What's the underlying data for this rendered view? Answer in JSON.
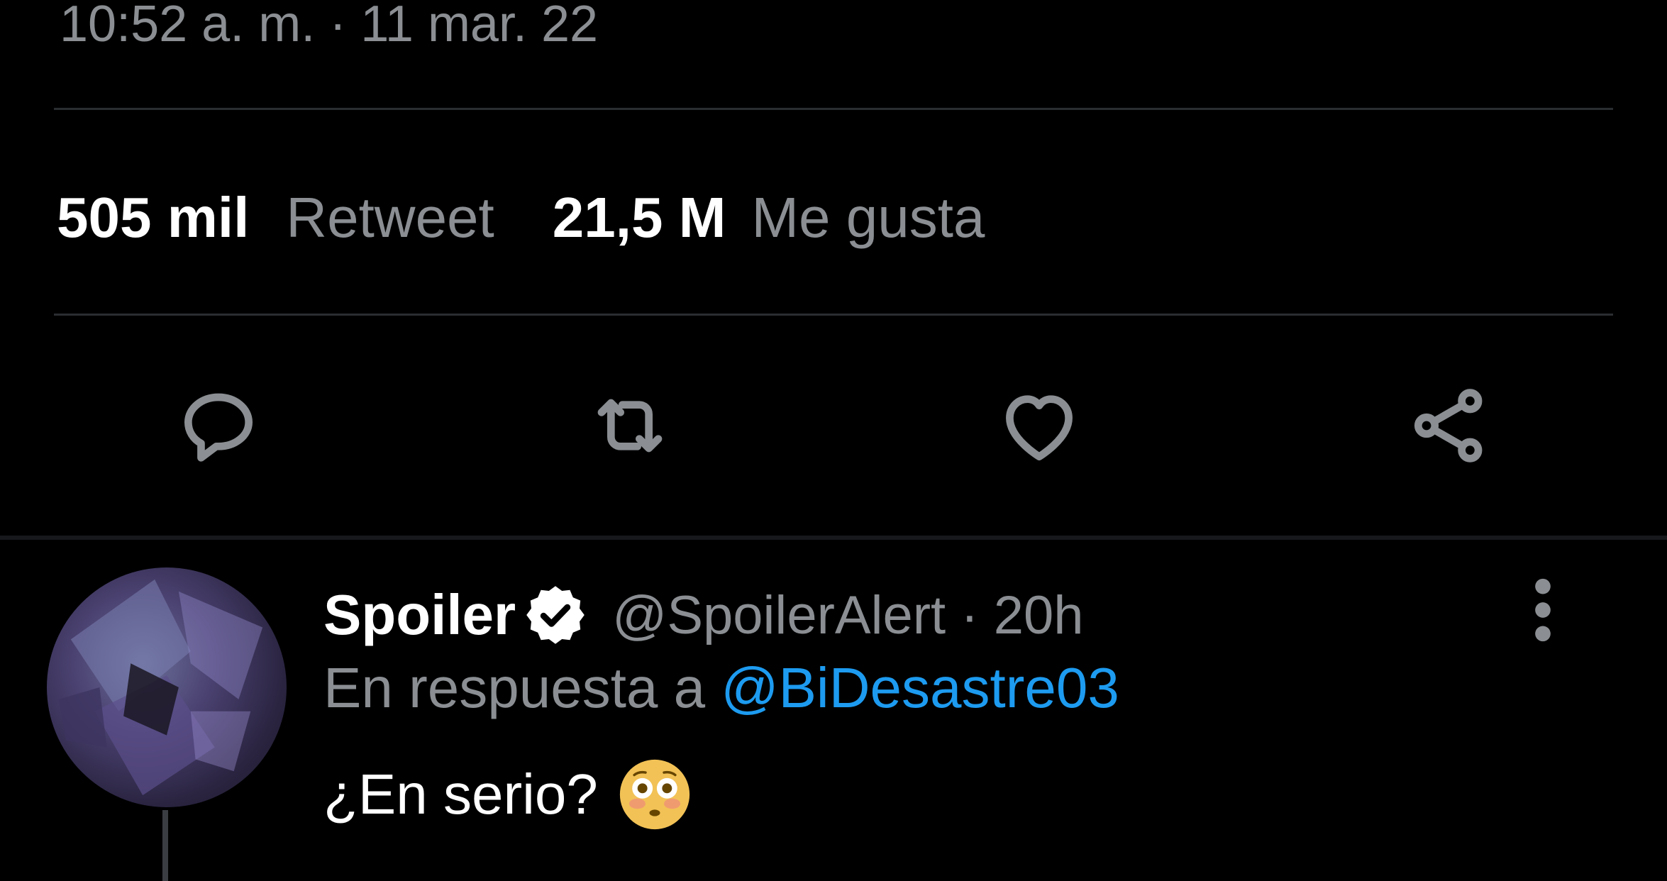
{
  "tweet": {
    "timestamp": "10:52 a. m. · 11 mar. 22",
    "stats": {
      "retweets_count": "505 mil",
      "retweets_label": "Retweet",
      "likes_count": "21,5 M",
      "likes_label": "Me gusta"
    },
    "actions": [
      {
        "name": "reply",
        "icon": "reply-icon"
      },
      {
        "name": "retweet",
        "icon": "retweet-icon"
      },
      {
        "name": "like",
        "icon": "heart-icon"
      },
      {
        "name": "share",
        "icon": "share-icon"
      }
    ]
  },
  "reply": {
    "display_name": "Spoiler",
    "verified": true,
    "handle_time": "@SpoilerAlert · 20h",
    "reply_prefix": "En respuesta a ",
    "reply_mention": "@BiDesastre03",
    "text": "¿En serio?",
    "emoji": "flushed-face-emoji",
    "more_icon": "more-vertical-icon"
  },
  "colors": {
    "background": "#000000",
    "text_primary": "#ffffff",
    "text_secondary": "#8b8f93",
    "accent": "#1d9bf0",
    "divider": "#2a2d30"
  }
}
